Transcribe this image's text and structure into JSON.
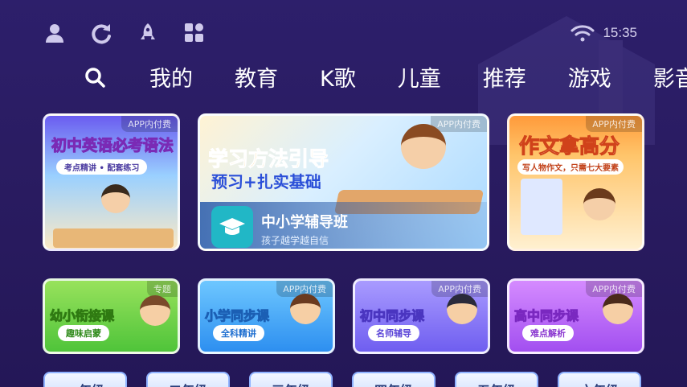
{
  "status": {
    "time": "15:35"
  },
  "top_icons": [
    "user-icon",
    "refresh-icon",
    "rocket-icon",
    "apps-grid-icon"
  ],
  "nav": {
    "tabs": [
      "我的",
      "教育",
      "K歌",
      "儿童",
      "推荐",
      "游戏",
      "影音"
    ]
  },
  "row1": [
    {
      "title": "初中英语必考语法",
      "pill": "考点精讲 • 配套练习",
      "badge": "APP内付费"
    },
    {
      "title_line1": "学习方法引导",
      "title_line2": "预习+扎实基础",
      "name": "中小学辅导班",
      "subtitle": "孩子越学越自信",
      "badge": "APP内付费"
    },
    {
      "title": "作文拿高分",
      "pill": "写人物作文，只需七大要素",
      "badge": "APP内付费"
    }
  ],
  "row2": [
    {
      "title": "幼小衔接课",
      "pill": "趣味启蒙",
      "badge": "专题"
    },
    {
      "title": "小学同步课",
      "pill": "全科精讲",
      "badge": "APP内付费"
    },
    {
      "title": "初中同步课",
      "pill": "名师辅导",
      "badge": "APP内付费"
    },
    {
      "title": "高中同步课",
      "pill": "难点解析",
      "badge": "APP内付费"
    }
  ],
  "grades": [
    "一年级",
    "二年级",
    "三年级",
    "四年级",
    "五年级",
    "六年级"
  ]
}
